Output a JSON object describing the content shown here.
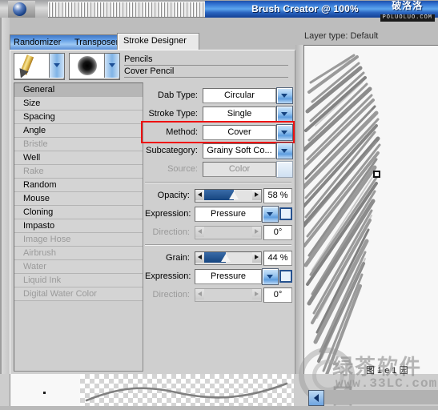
{
  "window": {
    "title": "Brush Creator @ 100%",
    "watermark_cn": "破洛洛",
    "watermark_en": "POLUOLUO.COM",
    "logo_icon": "corel-painter-logo-icon",
    "grip_icon": "title-grip-icon"
  },
  "tabs": [
    {
      "label": "Randomizer",
      "name": "tab-randomizer",
      "active": false
    },
    {
      "label": "Transposer",
      "name": "tab-transposer",
      "active": false
    },
    {
      "label": "Stroke Designer",
      "name": "tab-stroke-designer",
      "active": true
    }
  ],
  "brush": {
    "category": "Pencils",
    "variant": "Cover Pencil",
    "category_icon": "pencil-brush-icon",
    "variant_icon": "soft-round-dab-icon",
    "dropdown_icon": "chevron-down-icon"
  },
  "sections": [
    {
      "label": "General",
      "selected": true,
      "enabled": true
    },
    {
      "label": "Size",
      "selected": false,
      "enabled": true
    },
    {
      "label": "Spacing",
      "selected": false,
      "enabled": true
    },
    {
      "label": "Angle",
      "selected": false,
      "enabled": true
    },
    {
      "label": "Bristle",
      "selected": false,
      "enabled": false
    },
    {
      "label": "Well",
      "selected": false,
      "enabled": true
    },
    {
      "label": "Rake",
      "selected": false,
      "enabled": false
    },
    {
      "label": "Random",
      "selected": false,
      "enabled": true
    },
    {
      "label": "Mouse",
      "selected": false,
      "enabled": true
    },
    {
      "label": "Cloning",
      "selected": false,
      "enabled": true
    },
    {
      "label": "Impasto",
      "selected": false,
      "enabled": true
    },
    {
      "label": "Image Hose",
      "selected": false,
      "enabled": false
    },
    {
      "label": "Airbrush",
      "selected": false,
      "enabled": false
    },
    {
      "label": "Water",
      "selected": false,
      "enabled": false
    },
    {
      "label": "Liquid Ink",
      "selected": false,
      "enabled": false
    },
    {
      "label": "Digital Water Color",
      "selected": false,
      "enabled": false
    }
  ],
  "general": {
    "dab_type": {
      "label": "Dab Type:",
      "value": "Circular"
    },
    "stroke_type": {
      "label": "Stroke Type:",
      "value": "Single"
    },
    "method": {
      "label": "Method:",
      "value": "Cover",
      "highlighted": true
    },
    "subcategory": {
      "label": "Subcategory:",
      "value": "Grainy Soft Co..."
    },
    "source": {
      "label": "Source:",
      "value": "Color",
      "enabled": false
    }
  },
  "opacity": {
    "label": "Opacity:",
    "value_text": "58 %",
    "value": 58,
    "expression_label": "Expression:",
    "expression_value": "Pressure",
    "direction_label": "Direction:",
    "direction_text": "0°",
    "direction_value": 0,
    "direction_enabled": false,
    "invert_checked": false
  },
  "grain": {
    "label": "Grain:",
    "value_text": "44 %",
    "value": 44,
    "expression_label": "Expression:",
    "expression_value": "Pressure",
    "direction_label": "Direction:",
    "direction_text": "0°",
    "direction_value": 0,
    "direction_enabled": false,
    "invert_checked": false
  },
  "canvas": {
    "layer_type_label": "Layer type: Default",
    "scribble_icon": "pencil-scribble-preview",
    "marker_icon": "cursor-marker-icon",
    "stroke_preview_icon": "stroke-preview-curve"
  },
  "footer": {
    "watermark_cn": "绿茶软件园",
    "watermark_en": "www.33LC.com",
    "watermark_small": "图 1 e 1 园",
    "back_icon": "left-arrow-icon"
  },
  "colors": {
    "title_blue": "#2f6fd0",
    "highlight_red": "#ee1111",
    "slider_fill": "#15447f",
    "panel_bg": "#cfcfcf"
  }
}
